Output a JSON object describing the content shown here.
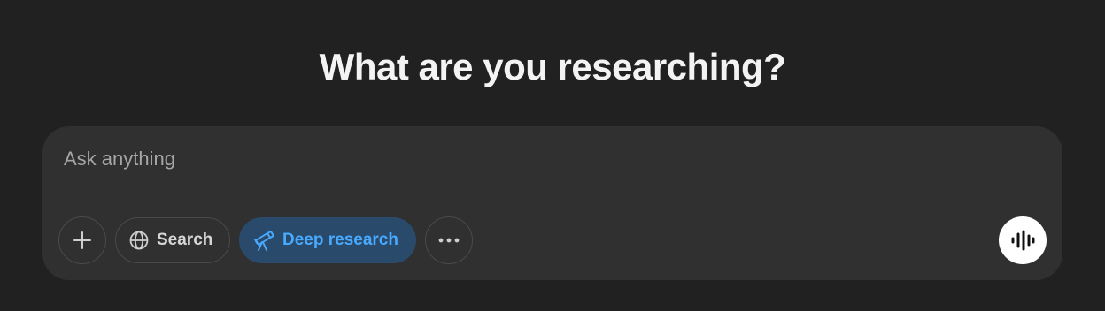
{
  "heading": "What are you researching?",
  "composer": {
    "placeholder": "Ask anything",
    "value": ""
  },
  "toolbar": {
    "add_icon": "plus-icon",
    "search_label": "Search",
    "search_icon": "globe-icon",
    "deep_research_label": "Deep research",
    "deep_research_icon": "telescope-icon",
    "deep_research_active": true,
    "more_icon": "ellipsis-icon",
    "voice_icon": "voice-waveform-icon"
  },
  "colors": {
    "background": "#212121",
    "composer": "#303030",
    "accent": "#48aaff",
    "accent_bg": "#2a4a6b"
  }
}
